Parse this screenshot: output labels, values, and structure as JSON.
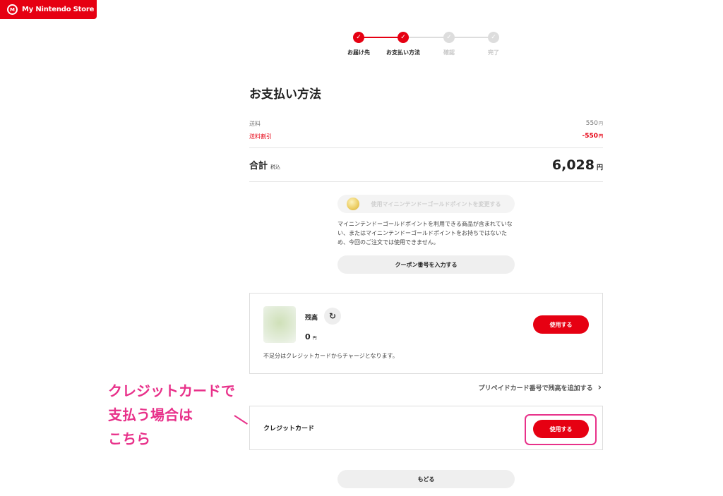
{
  "brand": {
    "name": "My Nintendo Store",
    "color": "#e60012",
    "icon": "my-nintendo-logo-icon"
  },
  "steps": [
    {
      "label": "お届け先",
      "state": "done"
    },
    {
      "label": "お支払い方法",
      "state": "done"
    },
    {
      "label": "確認",
      "state": "todo"
    },
    {
      "label": "完了",
      "state": "todo"
    }
  ],
  "page_title": "お支払い方法",
  "fees": {
    "shipping_label": "送料",
    "shipping_value": "550",
    "discount_label": "送料割引",
    "discount_value": "-550",
    "currency": "円"
  },
  "total": {
    "label": "合計",
    "tax": "税込",
    "value": "6,028",
    "currency": "円"
  },
  "gold_points": {
    "button_label": "使用マイニンテンドーゴールドポイントを変更する",
    "note": "マイニンテンドーゴールドポイントを利用できる商品が含まれていない、またはマイニンテンドーゴールドポイントをお持ちではないため、今回のご注文では使用できません。"
  },
  "coupon_button": "クーポン番号を入力する",
  "balance_card": {
    "label": "残高",
    "value": "0",
    "currency": "円",
    "use_button": "使用する",
    "note": "不足分はクレジットカードからチャージとなります。"
  },
  "prepaid_link": "プリペイドカード番号で残高を追加する",
  "credit_card": {
    "label": "クレジットカード",
    "use_button": "使用する"
  },
  "back_button": "もどる",
  "annotation": {
    "line1": "クレジットカードで",
    "line2": "支払う場合は",
    "line3": "こちら",
    "color": "#e8318a"
  }
}
